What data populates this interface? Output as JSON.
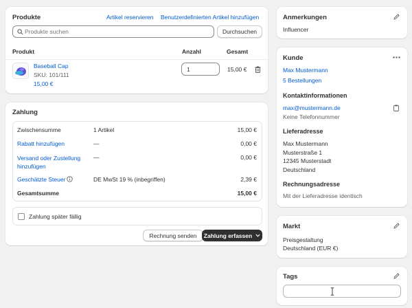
{
  "products": {
    "title": "Produkte",
    "reserve_link": "Artikel reservieren",
    "custom_link": "Benutzerdefinierten Artikel hinzufügen",
    "search_placeholder": "Produkte suchen",
    "browse_button": "Durchsuchen",
    "columns": {
      "product": "Produkt",
      "qty": "Anzahl",
      "total": "Gesamt"
    },
    "item": {
      "name": "Baseball Cap",
      "sku": "SKU: 101/111",
      "price": "15,00 €",
      "qty": "1",
      "total": "15,00 €"
    }
  },
  "payment": {
    "title": "Zahlung",
    "rows": [
      {
        "label": "Zwischensumme",
        "detail": "1 Artikel",
        "amount": "15,00 €"
      },
      {
        "label": "Rabatt hinzufügen",
        "detail": "—",
        "amount": "0,00 €"
      },
      {
        "label": "Versand oder Zustellung",
        "label2": "hinzufügen",
        "detail": "—",
        "amount": "0,00 €"
      },
      {
        "label": "Geschätzte Steuer",
        "detail": "DE MwSt 19 % (inbegriffen)",
        "amount": "2,39 €"
      },
      {
        "label": "Gesamtsumme",
        "detail": "",
        "amount": "15,00 €"
      }
    ],
    "later_checkbox": "Zahlung später fällig",
    "send_invoice": "Rechnung senden",
    "capture_payment": "Zahlung erfassen"
  },
  "notes": {
    "title": "Anmerkungen",
    "value": "Influencer"
  },
  "customer": {
    "title": "Kunde",
    "name": "Max Mustermann",
    "orders": "5 Bestellungen",
    "contact_title": "Kontaktinformationen",
    "email": "max@mustermann.de",
    "phone": "Keine Telefonnummer",
    "shipping_title": "Lieferadresse",
    "shipping": [
      "Max Mustermann",
      "Musterstraße 1",
      "12345 Musterstadt",
      "Deutschland"
    ],
    "billing_title": "Rechnungsadresse",
    "billing": "Mit der Lieferadresse identisch"
  },
  "market": {
    "title": "Markt",
    "line1": "Preisgestaltung",
    "line2": "Deutschland (EUR €)"
  },
  "tags": {
    "title": "Tags",
    "placeholder": ""
  },
  "colors": {
    "link": "#005bd3",
    "primary": "#303030",
    "background": "#f1f1f1"
  }
}
